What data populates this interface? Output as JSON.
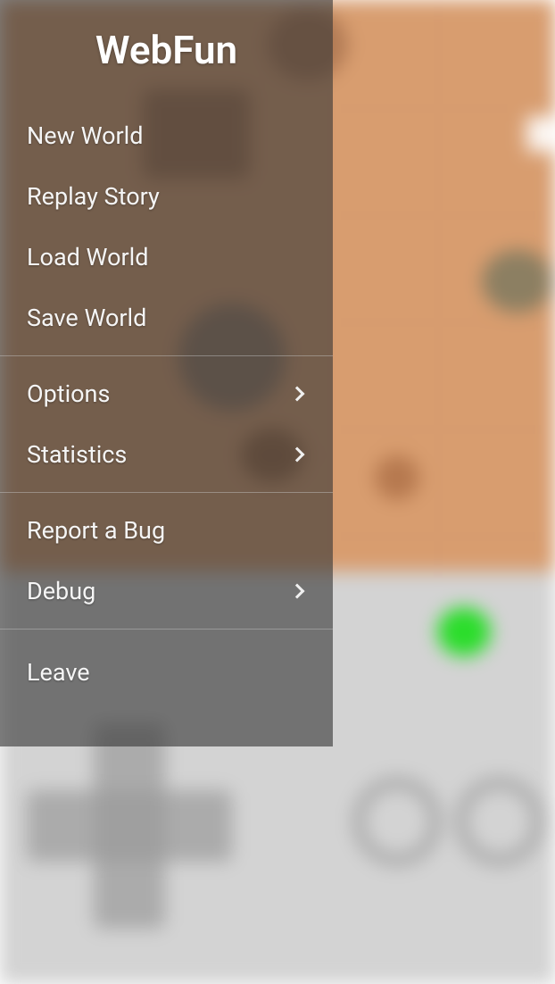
{
  "app_title": "WebFun",
  "menu": {
    "section1": [
      {
        "label": "New World",
        "has_submenu": false
      },
      {
        "label": "Replay Story",
        "has_submenu": false
      },
      {
        "label": "Load World",
        "has_submenu": false
      },
      {
        "label": "Save World",
        "has_submenu": false
      }
    ],
    "section2": [
      {
        "label": "Options",
        "has_submenu": true
      },
      {
        "label": "Statistics",
        "has_submenu": true
      }
    ],
    "section3": [
      {
        "label": "Report a Bug",
        "has_submenu": false
      },
      {
        "label": "Debug",
        "has_submenu": true
      }
    ],
    "section4": [
      {
        "label": "Leave",
        "has_submenu": false
      }
    ]
  }
}
